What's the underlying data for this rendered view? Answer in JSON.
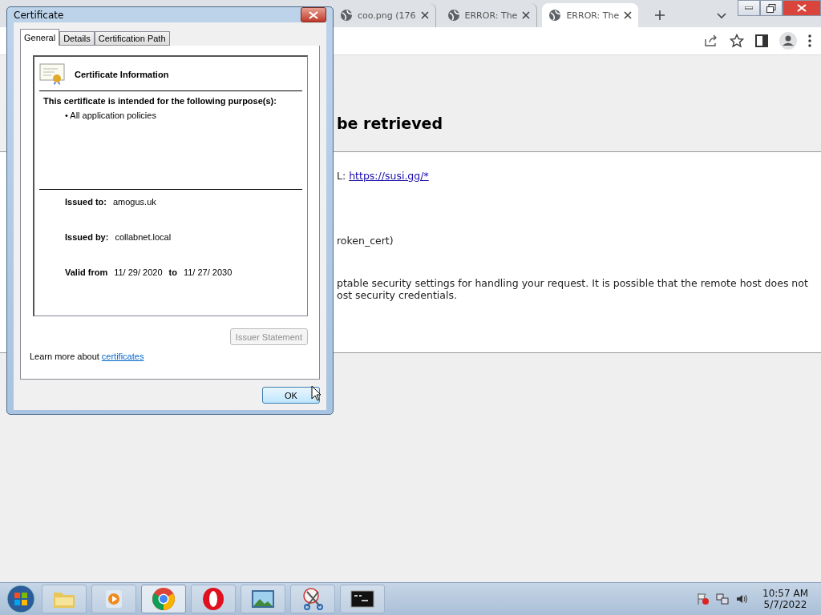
{
  "browser": {
    "tabs": [
      {
        "title": "coo.png (176",
        "selected": false
      },
      {
        "title": "ERROR: The",
        "selected": false
      },
      {
        "title": "ERROR: The",
        "selected": true
      }
    ],
    "page": {
      "heading": "be retrieved",
      "url_label": "L:",
      "url": "https://susi.gg/*",
      "error_code": "roken_cert)",
      "message_lines": [
        "ptable security settings for handling your request. It is possible that the remote host does not",
        "ost security credentials."
      ]
    }
  },
  "dialog": {
    "title": "Certificate",
    "tabs": [
      {
        "label": "General",
        "selected": true
      },
      {
        "label": "Details",
        "selected": false
      },
      {
        "label": "Certification Path",
        "selected": false
      }
    ],
    "heading": "Certificate Information",
    "purpose_title": "This certificate is intended for the following purpose(s):",
    "purposes": [
      "• All application policies"
    ],
    "fields": [
      {
        "label": "Issued to:",
        "value": "amogus.uk"
      },
      {
        "label": "Issued by:",
        "value": "collabnet.local"
      }
    ],
    "valid": {
      "label": "Valid from",
      "from": "11/ 29/ 2020",
      "to_label": "to",
      "to": "11/ 27/ 2030"
    },
    "issuer_button": {
      "label": "Issuer Statement",
      "disabled": true
    },
    "learn_more": {
      "text": "Learn more about",
      "link": "certificates"
    },
    "ok": "OK"
  },
  "taskbar": {
    "apps": [
      {
        "kind": "explorer",
        "active": false
      },
      {
        "kind": "media",
        "active": false
      },
      {
        "kind": "chrome",
        "active": true
      },
      {
        "kind": "opera",
        "active": false
      },
      {
        "kind": "photos",
        "active": false
      },
      {
        "kind": "snip",
        "active": false
      },
      {
        "kind": "cmd",
        "active": false
      }
    ],
    "clock": {
      "time": "10:57 AM",
      "date": "5/7/2022"
    }
  }
}
